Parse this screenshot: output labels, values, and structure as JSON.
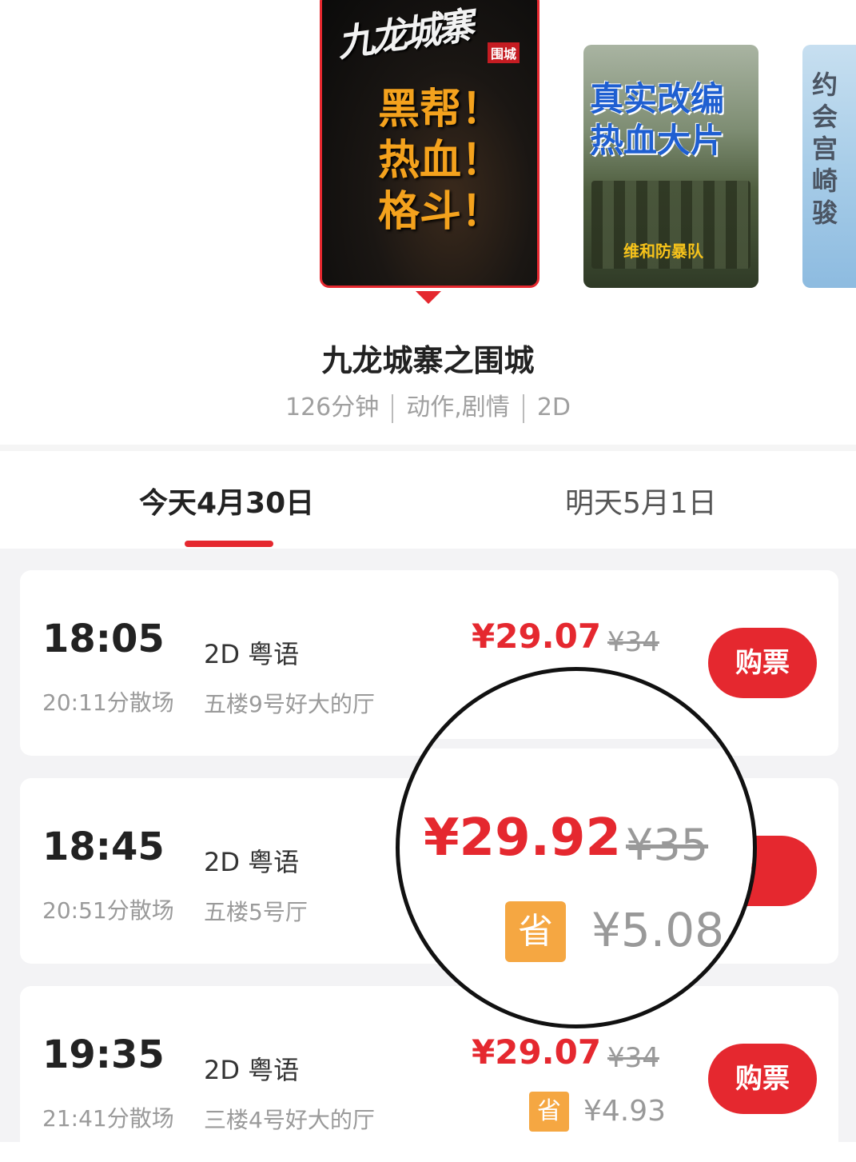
{
  "carousel": {
    "posters": [
      {
        "logo_text": "九龙城寨",
        "badge": "围城",
        "slogan": "黑帮！热血！格斗！"
      },
      {
        "headline": "真实改编热血大片",
        "film_title": "维和防暴队"
      },
      {
        "vertical_text": "约会宫崎骏"
      }
    ]
  },
  "movie": {
    "title": "九龙城寨之围城",
    "duration": "126分钟",
    "genres": "动作,剧情",
    "format": "2D"
  },
  "date_tabs": [
    {
      "label": "今天4月30日",
      "selected": true
    },
    {
      "label": "明天5月1日",
      "selected": false
    }
  ],
  "showtimes": [
    {
      "start": "18:05",
      "end": "20:11分散场",
      "lang": "2D 粤语",
      "hall": "五楼9号好大的厅",
      "price": "¥29.07",
      "orig_price": "¥34",
      "save_badge": "",
      "save_amount": "",
      "buy_label": "购票"
    },
    {
      "start": "18:45",
      "end": "20:51分散场",
      "lang": "2D 粤语",
      "hall": "五楼5号厅",
      "price": "¥29.92",
      "orig_price": "¥35",
      "save_badge": "省",
      "save_amount": "¥5.08",
      "buy_label": "购票"
    },
    {
      "start": "19:35",
      "end": "21:41分散场",
      "lang": "2D 粤语",
      "hall": "三楼4号好大的厅",
      "price": "¥29.07",
      "orig_price": "¥34",
      "save_badge": "省",
      "save_amount": "¥4.93",
      "buy_label": "购票"
    }
  ],
  "magnifier": {
    "price": "¥29.92",
    "orig_price": "¥35",
    "save_badge": "省",
    "save_amount": "¥5.08",
    "button_partial": "票"
  },
  "colors": {
    "accent": "#e5282f",
    "save_badge": "#f5a742",
    "muted_text": "#9a9a9a",
    "list_background": "#f3f3f5"
  }
}
